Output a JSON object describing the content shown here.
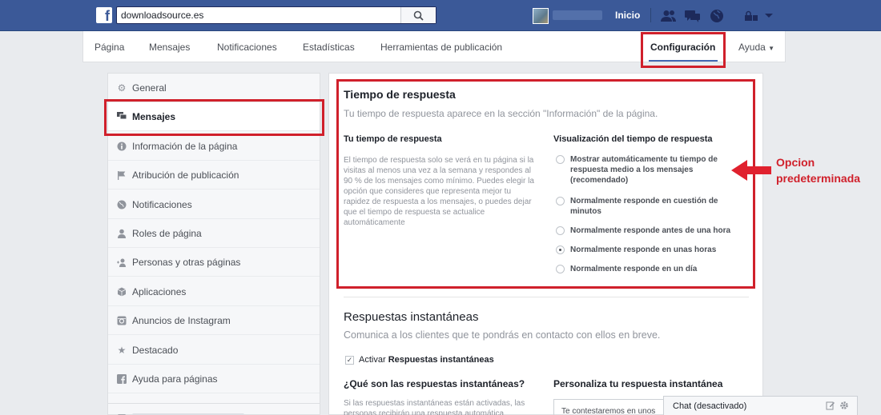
{
  "topbar": {
    "search_value": "downloadsource.es",
    "home_label": "Inicio",
    "icons": [
      "facebook-logo",
      "search-icon",
      "friend-requests-icon",
      "messages-icon",
      "notifications-globe-icon",
      "privacy-lock-icon",
      "chevron-down-icon"
    ],
    "brand_color": "#3b5998"
  },
  "page_tabs": {
    "items": [
      "Página",
      "Mensajes",
      "Notificaciones",
      "Estadísticas",
      "Herramientas de publicación",
      "Configuración",
      "Ayuda"
    ],
    "active": "Configuración"
  },
  "sidebar": {
    "items": [
      {
        "label": "General",
        "icon": "gear-icon"
      },
      {
        "label": "Mensajes",
        "icon": "messages-icon"
      },
      {
        "label": "Información de la página",
        "icon": "info-icon"
      },
      {
        "label": "Atribución de publicación",
        "icon": "flag-icon"
      },
      {
        "label": "Notificaciones",
        "icon": "globe-icon"
      },
      {
        "label": "Roles de página",
        "icon": "person-icon"
      },
      {
        "label": "Personas y otras páginas",
        "icon": "add-person-icon"
      },
      {
        "label": "Aplicaciones",
        "icon": "cube-icon"
      },
      {
        "label": "Anuncios de Instagram",
        "icon": "instagram-icon"
      },
      {
        "label": "Destacado",
        "icon": "star-icon"
      },
      {
        "label": "Ayuda para páginas",
        "icon": "facebook-icon"
      }
    ],
    "active": "Mensajes"
  },
  "response_time": {
    "title": "Tiempo de respuesta",
    "subtitle": "Tu tiempo de respuesta aparece en la sección \"Información\" de la página.",
    "left_heading": "Tu tiempo de respuesta",
    "left_paragraph": "El tiempo de respuesta solo se verá en tu página si la visitas al menos una vez a la semana y respondes al 90 % de los mensajes como mínimo. Puedes elegir la opción que consideres que representa mejor tu rapidez de respuesta a los mensajes, o puedes dejar que el tiempo de respuesta se actualice automáticamente",
    "right_heading": "Visualización del tiempo de respuesta",
    "options": [
      {
        "label": "Mostrar automáticamente tu tiempo de respuesta medio a los mensajes (recomendado)",
        "checked": false
      },
      {
        "label": "Normalmente responde en cuestión de minutos",
        "checked": false
      },
      {
        "label": "Normalmente responde antes de una hora",
        "checked": false
      },
      {
        "label": "Normalmente responde en unas horas",
        "checked": true
      },
      {
        "label": "Normalmente responde en un día",
        "checked": false
      }
    ]
  },
  "annotation": {
    "line1": "Opcion",
    "line2": "predeterminada",
    "color": "#d0202b"
  },
  "instant_replies": {
    "title": "Respuestas instantáneas",
    "subtitle": "Comunica a los clientes que te pondrás en contacto con ellos en breve.",
    "checkbox_prefix": "Activar",
    "checkbox_bold": "Respuestas instantáneas",
    "checked": true,
    "left_heading": "¿Qué son las respuestas instantáneas?",
    "left_paragraph_line1": "Si las respuestas instantáneas están activadas, las",
    "left_paragraph_line2": "personas recibirán una respuesta automática",
    "right_heading": "Personaliza tu respuesta instantánea",
    "field_value": "Te contestaremos en unos m"
  },
  "chat": {
    "label": "Chat (desactivado)"
  }
}
